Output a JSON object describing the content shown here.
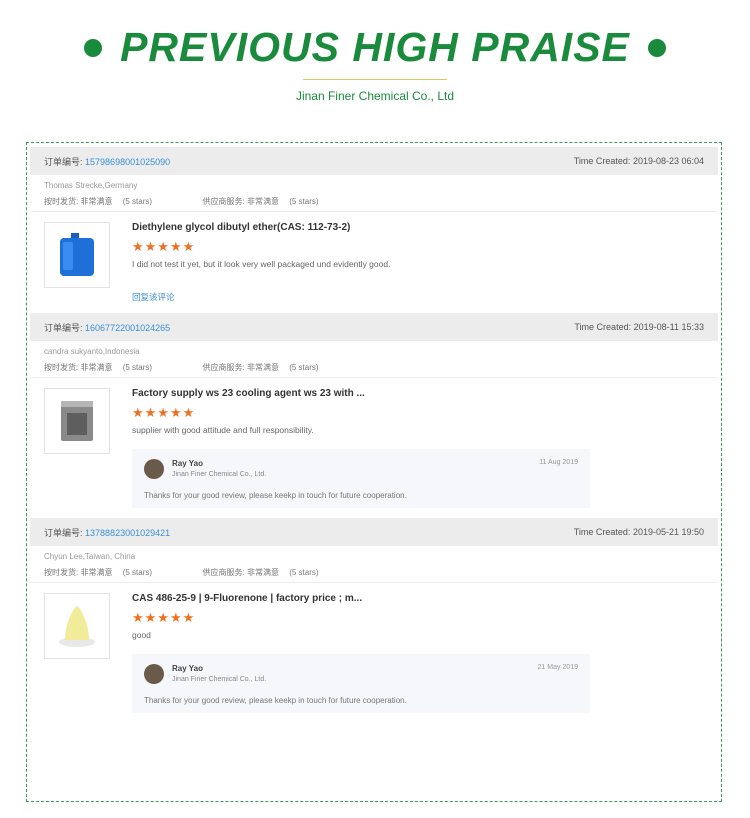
{
  "header": {
    "title": "PREVIOUS HIGH PRAISE",
    "subtitle": "Jinan Finer Chemical Co., Ltd"
  },
  "orders": [
    {
      "order_label": "订单编号:",
      "order_no": "15798698001025090",
      "time_label": "Time Created:",
      "time": "2019-08-23 06:04",
      "buyer": "Thomas Strecke,Germany",
      "rating1_label": "按时发货: 非常满意",
      "rating1_stars": "(5 stars)",
      "rating2_label": "供应商服务: 非常满意",
      "rating2_stars": "(5 stars)",
      "product": "Diethylene glycol dibutyl ether(CAS: 112-73-2)",
      "stars": "★★★★★",
      "comment": "I did not test it yet, but it look very well packaged und evidently good.",
      "reply_link": "回复该评论"
    },
    {
      "order_label": "订单编号:",
      "order_no": "16067722001024265",
      "time_label": "Time Created:",
      "time": "2019-08-11 15:33",
      "buyer": "candra sukyanto,Indonesia",
      "rating1_label": "按时发货: 非常满意",
      "rating1_stars": "(5 stars)",
      "rating2_label": "供应商服务: 非常满意",
      "rating2_stars": "(5 stars)",
      "product": "Factory supply ws 23 cooling agent ws 23 with ...",
      "stars": "★★★★★",
      "comment": "supplier with good attitude and full responsibility.",
      "reply": {
        "name": "Ray Yao",
        "company": "Jinan Finer Chemical Co., Ltd.",
        "date": "11 Aug 2019",
        "text": "Thanks for your good review, please keekp in touch for future cooperation."
      }
    },
    {
      "order_label": "订单编号:",
      "order_no": "13788823001029421",
      "time_label": "Time Created:",
      "time": "2019-05-21 19:50",
      "buyer": "Chyun Lee,Taiwan, China",
      "rating1_label": "按时发货: 非常满意",
      "rating1_stars": "(5 stars)",
      "rating2_label": "供应商服务: 非常满意",
      "rating2_stars": "(5 stars)",
      "product": "CAS 486-25-9 | 9-Fluorenone | factory price ; m...",
      "stars": "★★★★★",
      "comment": "good",
      "reply": {
        "name": "Ray Yao",
        "company": "Jinan Finer Chemical Co., Ltd.",
        "date": "21 May 2019",
        "text": "Thanks for your good review, please keekp in touch for future cooperation."
      }
    }
  ]
}
